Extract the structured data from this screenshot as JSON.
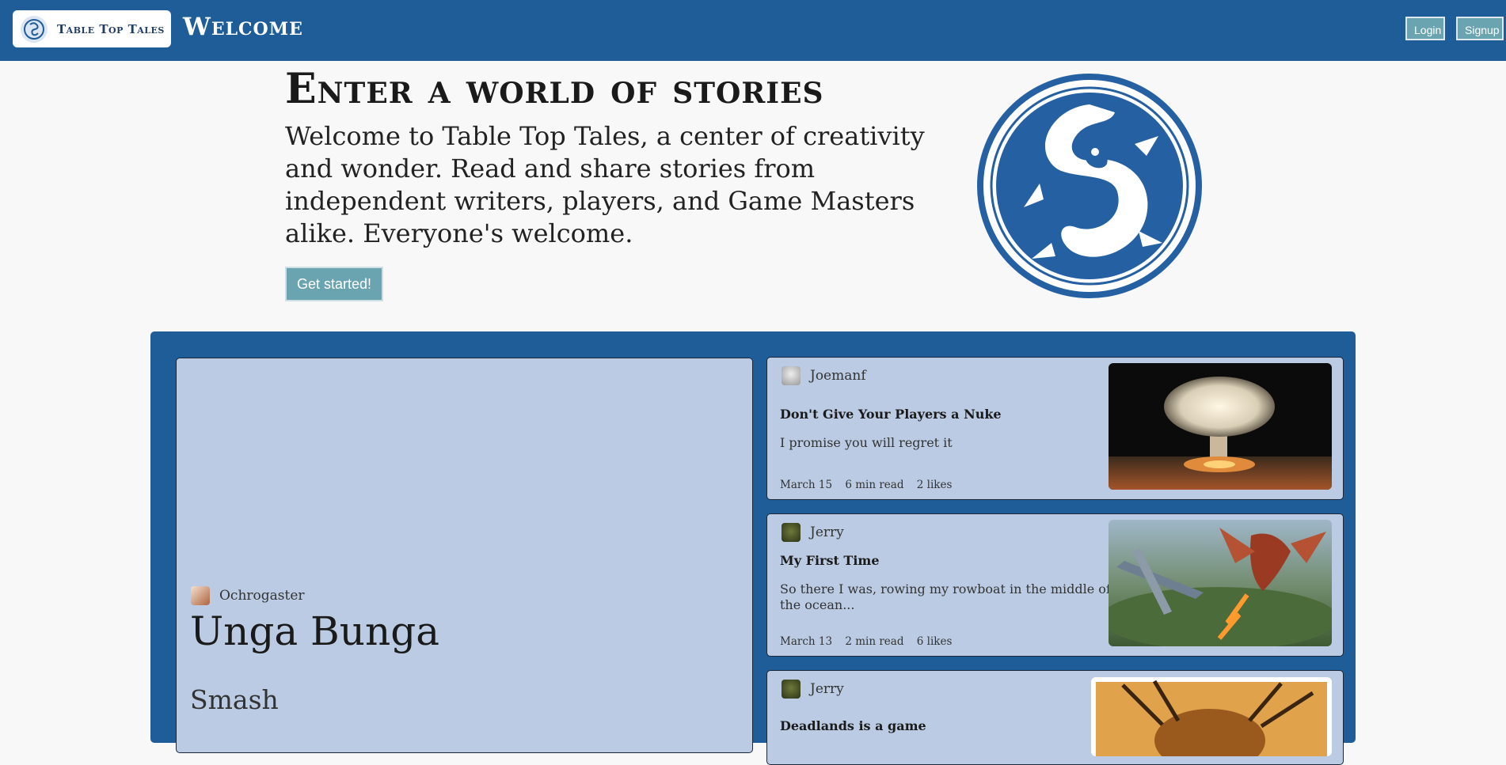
{
  "nav": {
    "brand": "Table Top Tales",
    "title": "Welcome",
    "login": "Login",
    "signup": "Signup"
  },
  "hero": {
    "title": "Enter a world of stories",
    "text": "Welcome to Table Top Tales, a center of creativity and wonder. Read and share stories from independent writers, players, and Game Masters alike. Everyone's welcome.",
    "button": "Get started!"
  },
  "featured": {
    "author": "Ochrogaster",
    "title": "Unga Bunga",
    "subtitle": "Smash"
  },
  "stories": [
    {
      "author": "Joemanf",
      "title": "Don't Give Your Players a Nuke",
      "description": "I promise you will regret it",
      "date": "March 15",
      "read_time": "6 min read",
      "likes": "2 likes"
    },
    {
      "author": "Jerry",
      "title": "My First Time",
      "description": "So there I was, rowing my rowboat in the middle of the ocean...",
      "date": "March 13",
      "read_time": "2 min read",
      "likes": "6 likes"
    },
    {
      "author": "Jerry",
      "title": "Deadlands is a game"
    }
  ],
  "colors": {
    "primary": "#1f5d99",
    "card": "#bacbe3",
    "button": "#6aa4b0"
  }
}
